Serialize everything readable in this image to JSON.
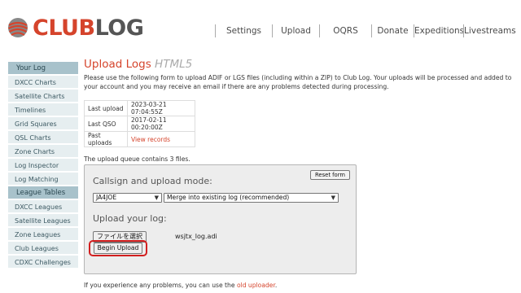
{
  "header": {
    "logo_club": "CLUB",
    "logo_log": "LOG",
    "nav": [
      "Settings",
      "Upload",
      "OQRS",
      "Donate",
      "Expeditions",
      "Livestreams"
    ]
  },
  "sidebar": {
    "section1": "Your Log",
    "items1": [
      "DXCC Charts",
      "Satellite Charts",
      "Timelines",
      "Grid Squares",
      "QSL Charts",
      "Zone Charts",
      "Log Inspector",
      "Log Matching"
    ],
    "section2": "League Tables",
    "items2": [
      "DXCC Leagues",
      "Satellite Leagues",
      "Zone Leagues",
      "Club Leagues",
      "CDXC Challenges"
    ]
  },
  "main": {
    "title": "Upload Logs",
    "title_sub": "HTML5",
    "intro": "Please use the following form to upload ADIF or LGS files (including within a ZIP) to Club Log. Your uploads will be processed and added to your account and you may receive an email if there are any problems detected during processing.",
    "info": {
      "last_upload_label": "Last upload",
      "last_upload_value": "2023-03-21 07:04:55Z",
      "last_qso_label": "Last QSO",
      "last_qso_value": "2017-02-11 00:20:00Z",
      "past_uploads_label": "Past uploads",
      "past_uploads_link": "View records"
    },
    "queue_text": "The upload queue contains 3 files.",
    "form": {
      "reset_label": "Reset form",
      "callsign_heading": "Callsign and upload mode:",
      "callsign_value": "JA4JOE",
      "mode_value": "Merge into existing log (recommended)",
      "upload_heading": "Upload your log:",
      "file_button": "ファイルを選択",
      "file_name": "wsjtx_log.adi",
      "begin_label": "Begin Upload"
    },
    "footer_prefix": "If you experience any problems, you can use the",
    "footer_link": "old uploader",
    "footer_suffix": "."
  },
  "colors": {
    "brand": "#d5442c",
    "sidebar_head": "#a8c2cb",
    "sidebar_item": "#e6eef0",
    "highlight": "#d21f1f"
  }
}
